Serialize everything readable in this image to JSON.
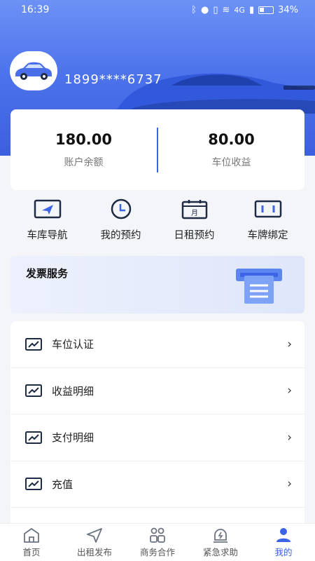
{
  "status_bar": {
    "time": "16:39",
    "network": "4G",
    "battery": "34%"
  },
  "profile": {
    "phone": "1899****6737"
  },
  "balance": {
    "account": {
      "value": "180.00",
      "label": "账户余额"
    },
    "parking": {
      "value": "80.00",
      "label": "车位收益"
    }
  },
  "quick_actions": [
    {
      "label": "车库导航",
      "icon": "navigation-icon"
    },
    {
      "label": "我的预约",
      "icon": "clock-icon"
    },
    {
      "label": "日租预约",
      "icon": "calendar-icon"
    },
    {
      "label": "车牌绑定",
      "icon": "license-plate-icon"
    }
  ],
  "calendar_glyph": "月",
  "invoice": {
    "title": "发票服务",
    "icon": "invoice-printer-icon"
  },
  "menu": [
    {
      "label": "车位认证"
    },
    {
      "label": "收益明细"
    },
    {
      "label": "支付明细"
    },
    {
      "label": "充值"
    }
  ],
  "tabbar": [
    {
      "label": "首页",
      "icon": "home-icon"
    },
    {
      "label": "出租发布",
      "icon": "send-icon"
    },
    {
      "label": "商务合作",
      "icon": "partners-icon"
    },
    {
      "label": "紧急求助",
      "icon": "emergency-icon"
    },
    {
      "label": "我的",
      "icon": "profile-icon",
      "active": true
    }
  ],
  "colors": {
    "accent": "#3d64e6",
    "hero_top": "#6c92f6",
    "hero_bottom": "#3c5fe0",
    "icon_dark": "#1f2a44"
  }
}
